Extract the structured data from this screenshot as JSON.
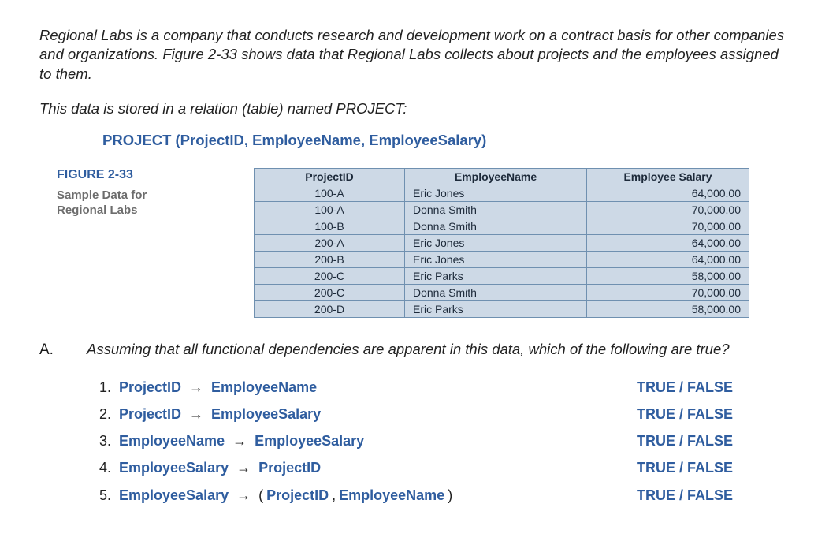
{
  "intro": {
    "para1": "Regional Labs is a company that conducts research and development work on a contract basis for other companies and organizations. Figure 2-33 shows data that Regional Labs collects about projects and the employees assigned to them.",
    "para2": "This data is stored in a relation (table) named PROJECT:"
  },
  "schema_line": "PROJECT (ProjectID, EmployeeName, EmployeeSalary)",
  "figure": {
    "number": "FIGURE 2-33",
    "caption_line1": "Sample Data for",
    "caption_line2": "Regional Labs"
  },
  "table": {
    "headers": [
      "ProjectID",
      "EmployeeName",
      "Employee Salary"
    ],
    "rows": [
      {
        "pid": "100-A",
        "name": "Eric Jones",
        "salary": "64,000.00"
      },
      {
        "pid": "100-A",
        "name": "Donna Smith",
        "salary": "70,000.00"
      },
      {
        "pid": "100-B",
        "name": "Donna Smith",
        "salary": "70,000.00"
      },
      {
        "pid": "200-A",
        "name": "Eric Jones",
        "salary": "64,000.00"
      },
      {
        "pid": "200-B",
        "name": "Eric Jones",
        "salary": "64,000.00"
      },
      {
        "pid": "200-C",
        "name": "Eric Parks",
        "salary": "58,000.00"
      },
      {
        "pid": "200-C",
        "name": "Donna Smith",
        "salary": "70,000.00"
      },
      {
        "pid": "200-D",
        "name": "Eric Parks",
        "salary": "58,000.00"
      }
    ]
  },
  "question": {
    "letter": "A.",
    "stem": "Assuming that all functional dependencies are apparent in this data, which of the following are true?",
    "tf_label": "TRUE / FALSE",
    "items": [
      {
        "num": "1.",
        "parts": [
          {
            "kw": "ProjectID"
          },
          {
            "arrow": "→"
          },
          {
            "kw": "EmployeeName"
          }
        ]
      },
      {
        "num": "2.",
        "parts": [
          {
            "kw": "ProjectID"
          },
          {
            "arrow": "→"
          },
          {
            "kw": "EmployeeSalary"
          }
        ]
      },
      {
        "num": "3.",
        "parts": [
          {
            "kw": "EmployeeName"
          },
          {
            "arrow": "→"
          },
          {
            "kw": "EmployeeSalary"
          }
        ]
      },
      {
        "num": "4.",
        "parts": [
          {
            "kw": "EmployeeSalary"
          },
          {
            "arrow": "→"
          },
          {
            "kw": "ProjectID"
          }
        ]
      },
      {
        "num": "5.",
        "parts": [
          {
            "kw": "EmployeeSalary"
          },
          {
            "arrow": "→"
          },
          {
            "txt": "("
          },
          {
            "kw": "ProjectID"
          },
          {
            "txt": ", "
          },
          {
            "kw": "EmployeeName"
          },
          {
            "txt": ")"
          }
        ]
      }
    ]
  }
}
